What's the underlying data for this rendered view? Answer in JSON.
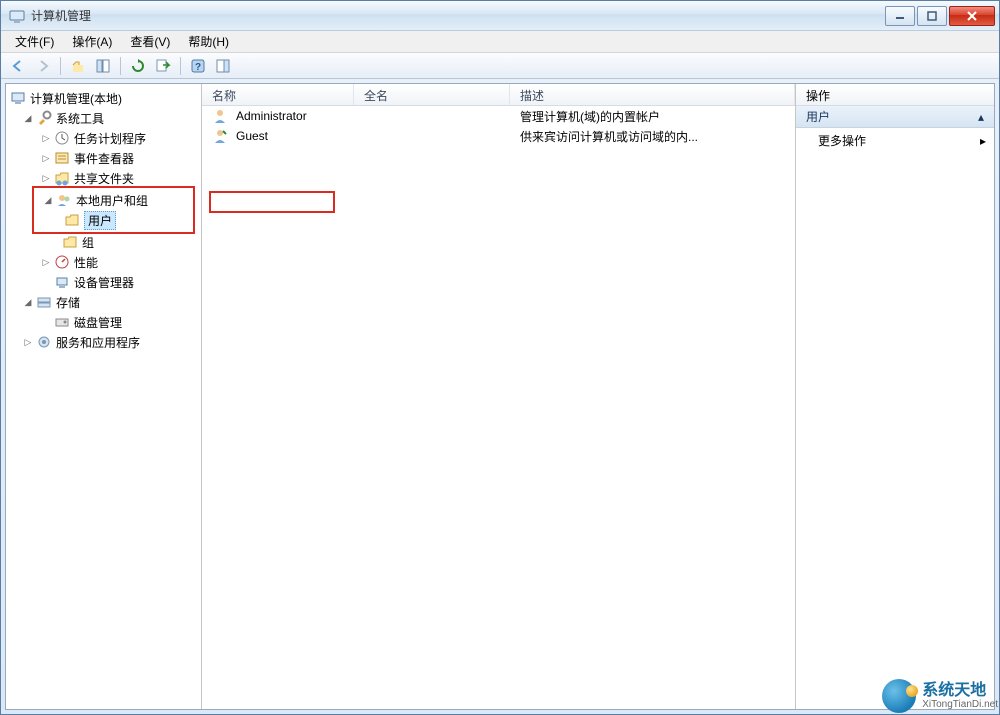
{
  "window": {
    "title": "计算机管理"
  },
  "menu": {
    "file": "文件(F)",
    "action": "操作(A)",
    "view": "查看(V)",
    "help": "帮助(H)"
  },
  "tree": {
    "root": "计算机管理(本地)",
    "systemTools": "系统工具",
    "taskScheduler": "任务计划程序",
    "eventViewer": "事件查看器",
    "sharedFolders": "共享文件夹",
    "localUsersGroups": "本地用户和组",
    "users": "用户",
    "groups": "组",
    "performance": "性能",
    "deviceManager": "设备管理器",
    "storage": "存储",
    "diskManagement": "磁盘管理",
    "servicesApps": "服务和应用程序"
  },
  "cols": {
    "name": "名称",
    "fullname": "全名",
    "desc": "描述"
  },
  "rows": {
    "admin": {
      "name": "Administrator",
      "full": "",
      "desc": "管理计算机(域)的内置帐户"
    },
    "guest": {
      "name": "Guest",
      "full": "",
      "desc": "供来宾访问计算机或访问域的内..."
    }
  },
  "actions": {
    "header": "操作",
    "sectionTitle": "用户",
    "more": "更多操作"
  },
  "watermark": {
    "line1": "系统天地",
    "line2": "XiTongTianDi.net"
  }
}
